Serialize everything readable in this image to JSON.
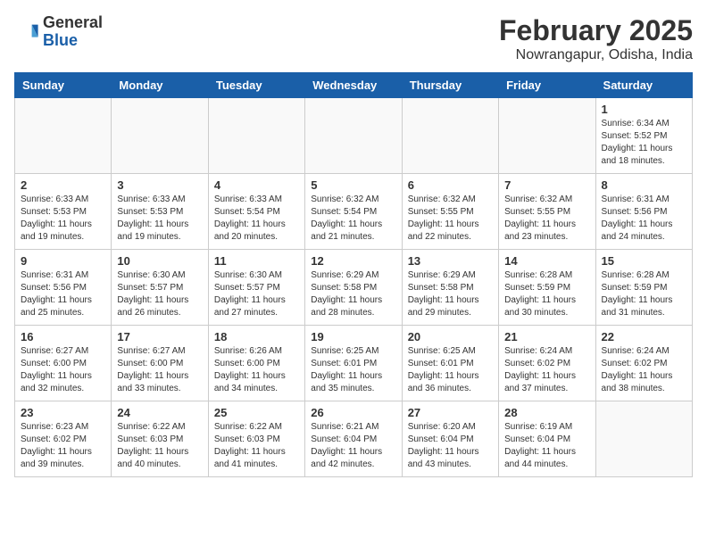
{
  "header": {
    "logo_general": "General",
    "logo_blue": "Blue",
    "month_year": "February 2025",
    "location": "Nowrangapur, Odisha, India"
  },
  "days_of_week": [
    "Sunday",
    "Monday",
    "Tuesday",
    "Wednesday",
    "Thursday",
    "Friday",
    "Saturday"
  ],
  "weeks": [
    [
      {
        "day": "",
        "info": ""
      },
      {
        "day": "",
        "info": ""
      },
      {
        "day": "",
        "info": ""
      },
      {
        "day": "",
        "info": ""
      },
      {
        "day": "",
        "info": ""
      },
      {
        "day": "",
        "info": ""
      },
      {
        "day": "1",
        "info": "Sunrise: 6:34 AM\nSunset: 5:52 PM\nDaylight: 11 hours\nand 18 minutes."
      }
    ],
    [
      {
        "day": "2",
        "info": "Sunrise: 6:33 AM\nSunset: 5:53 PM\nDaylight: 11 hours\nand 19 minutes."
      },
      {
        "day": "3",
        "info": "Sunrise: 6:33 AM\nSunset: 5:53 PM\nDaylight: 11 hours\nand 19 minutes."
      },
      {
        "day": "4",
        "info": "Sunrise: 6:33 AM\nSunset: 5:54 PM\nDaylight: 11 hours\nand 20 minutes."
      },
      {
        "day": "5",
        "info": "Sunrise: 6:32 AM\nSunset: 5:54 PM\nDaylight: 11 hours\nand 21 minutes."
      },
      {
        "day": "6",
        "info": "Sunrise: 6:32 AM\nSunset: 5:55 PM\nDaylight: 11 hours\nand 22 minutes."
      },
      {
        "day": "7",
        "info": "Sunrise: 6:32 AM\nSunset: 5:55 PM\nDaylight: 11 hours\nand 23 minutes."
      },
      {
        "day": "8",
        "info": "Sunrise: 6:31 AM\nSunset: 5:56 PM\nDaylight: 11 hours\nand 24 minutes."
      }
    ],
    [
      {
        "day": "9",
        "info": "Sunrise: 6:31 AM\nSunset: 5:56 PM\nDaylight: 11 hours\nand 25 minutes."
      },
      {
        "day": "10",
        "info": "Sunrise: 6:30 AM\nSunset: 5:57 PM\nDaylight: 11 hours\nand 26 minutes."
      },
      {
        "day": "11",
        "info": "Sunrise: 6:30 AM\nSunset: 5:57 PM\nDaylight: 11 hours\nand 27 minutes."
      },
      {
        "day": "12",
        "info": "Sunrise: 6:29 AM\nSunset: 5:58 PM\nDaylight: 11 hours\nand 28 minutes."
      },
      {
        "day": "13",
        "info": "Sunrise: 6:29 AM\nSunset: 5:58 PM\nDaylight: 11 hours\nand 29 minutes."
      },
      {
        "day": "14",
        "info": "Sunrise: 6:28 AM\nSunset: 5:59 PM\nDaylight: 11 hours\nand 30 minutes."
      },
      {
        "day": "15",
        "info": "Sunrise: 6:28 AM\nSunset: 5:59 PM\nDaylight: 11 hours\nand 31 minutes."
      }
    ],
    [
      {
        "day": "16",
        "info": "Sunrise: 6:27 AM\nSunset: 6:00 PM\nDaylight: 11 hours\nand 32 minutes."
      },
      {
        "day": "17",
        "info": "Sunrise: 6:27 AM\nSunset: 6:00 PM\nDaylight: 11 hours\nand 33 minutes."
      },
      {
        "day": "18",
        "info": "Sunrise: 6:26 AM\nSunset: 6:00 PM\nDaylight: 11 hours\nand 34 minutes."
      },
      {
        "day": "19",
        "info": "Sunrise: 6:25 AM\nSunset: 6:01 PM\nDaylight: 11 hours\nand 35 minutes."
      },
      {
        "day": "20",
        "info": "Sunrise: 6:25 AM\nSunset: 6:01 PM\nDaylight: 11 hours\nand 36 minutes."
      },
      {
        "day": "21",
        "info": "Sunrise: 6:24 AM\nSunset: 6:02 PM\nDaylight: 11 hours\nand 37 minutes."
      },
      {
        "day": "22",
        "info": "Sunrise: 6:24 AM\nSunset: 6:02 PM\nDaylight: 11 hours\nand 38 minutes."
      }
    ],
    [
      {
        "day": "23",
        "info": "Sunrise: 6:23 AM\nSunset: 6:02 PM\nDaylight: 11 hours\nand 39 minutes."
      },
      {
        "day": "24",
        "info": "Sunrise: 6:22 AM\nSunset: 6:03 PM\nDaylight: 11 hours\nand 40 minutes."
      },
      {
        "day": "25",
        "info": "Sunrise: 6:22 AM\nSunset: 6:03 PM\nDaylight: 11 hours\nand 41 minutes."
      },
      {
        "day": "26",
        "info": "Sunrise: 6:21 AM\nSunset: 6:04 PM\nDaylight: 11 hours\nand 42 minutes."
      },
      {
        "day": "27",
        "info": "Sunrise: 6:20 AM\nSunset: 6:04 PM\nDaylight: 11 hours\nand 43 minutes."
      },
      {
        "day": "28",
        "info": "Sunrise: 6:19 AM\nSunset: 6:04 PM\nDaylight: 11 hours\nand 44 minutes."
      },
      {
        "day": "",
        "info": ""
      }
    ]
  ]
}
